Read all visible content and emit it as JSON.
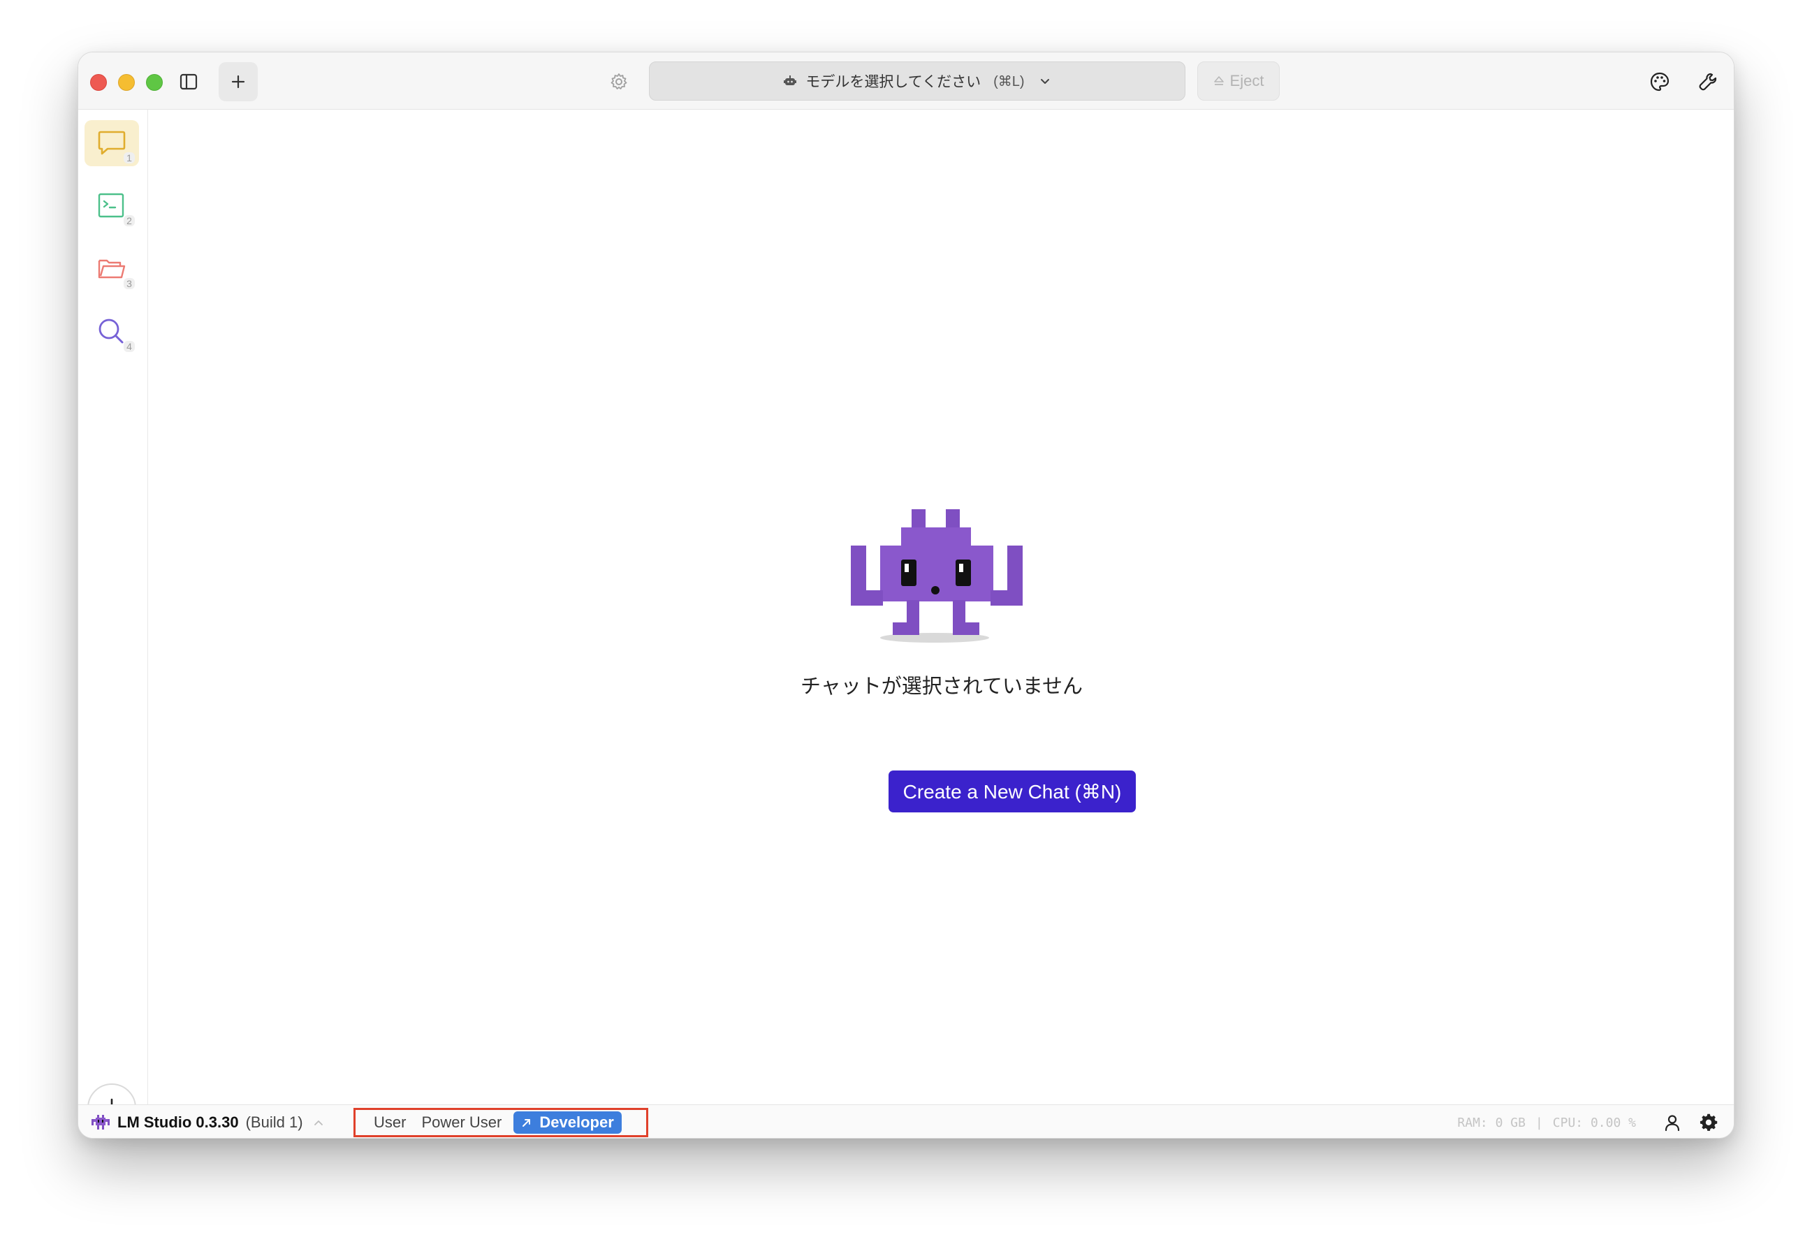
{
  "titlebar": {
    "model_selector_placeholder": "モデルを選択してください",
    "model_selector_shortcut": "(⌘L)",
    "eject_label": "Eject",
    "icons": [
      "sidebar-toggle-icon",
      "plus-icon",
      "gear-icon",
      "robot-icon",
      "chevron-down-icon",
      "eject-icon",
      "palette-icon",
      "wrench-icon"
    ]
  },
  "rail": {
    "items": [
      {
        "name": "chat",
        "badge": "1",
        "icon": "chat-bubble-icon",
        "color": "#e0ad2e",
        "active": true
      },
      {
        "name": "developer",
        "badge": "2",
        "icon": "terminal-icon",
        "color": "#4cc08a",
        "active": false
      },
      {
        "name": "my-models",
        "badge": "3",
        "icon": "folder-icon",
        "color": "#ec7a72",
        "active": false
      },
      {
        "name": "discover",
        "badge": "4",
        "icon": "search-icon",
        "color": "#7661d6",
        "active": false
      }
    ],
    "download_icon": "download-icon"
  },
  "main": {
    "empty_message": "チャットが選択されていません",
    "new_chat_button": "Create a New Chat (⌘N)",
    "button_color": "#3b22cc",
    "mascot_color": "#7f4fc2"
  },
  "statusbar": {
    "app_name": "LM Studio 0.3.30",
    "build": "(Build 1)",
    "modes": [
      "User",
      "Power User",
      "Developer"
    ],
    "active_mode": "Developer",
    "active_color": "#3d7edd",
    "highlight_color": "#e0412b",
    "ram": "RAM: 0 GB",
    "separator": "|",
    "cpu": "CPU: 0.00 %"
  }
}
